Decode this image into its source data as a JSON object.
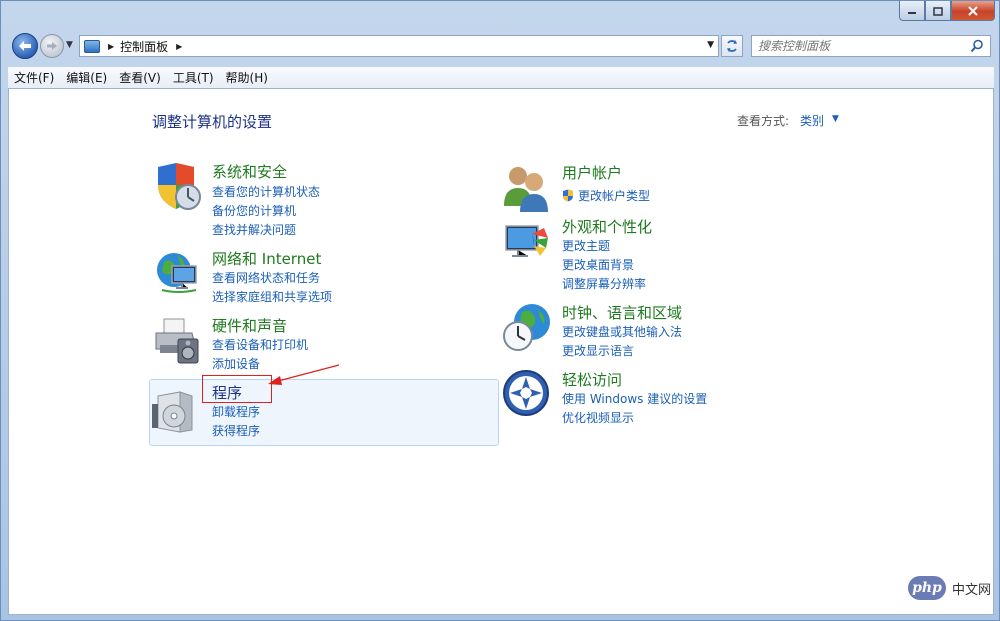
{
  "address": {
    "breadcrumb": "控制面板"
  },
  "search": {
    "placeholder": "搜索控制面板"
  },
  "menubar": {
    "items": [
      "文件(F)",
      "编辑(E)",
      "查看(V)",
      "工具(T)",
      "帮助(H)"
    ]
  },
  "main": {
    "title": "调整计算机的设置",
    "view_by_label": "查看方式:",
    "view_by_value": "类别"
  },
  "categories": [
    {
      "title": "系统和安全",
      "links": [
        "查看您的计算机状态",
        "备份您的计算机",
        "查找并解决问题"
      ]
    },
    {
      "title": "网络和 Internet",
      "links": [
        "查看网络状态和任务",
        "选择家庭组和共享选项"
      ]
    },
    {
      "title": "硬件和声音",
      "links": [
        "查看设备和打印机",
        "添加设备"
      ]
    },
    {
      "title": "程序",
      "links": [
        "卸载程序",
        "获得程序"
      ]
    },
    {
      "title": "用户帐户",
      "links": [
        "更改帐户类型"
      ]
    },
    {
      "title": "外观和个性化",
      "links": [
        "更改主题",
        "更改桌面背景",
        "调整屏幕分辨率"
      ]
    },
    {
      "title": "时钟、语言和区域",
      "links": [
        "更改键盘或其他输入法",
        "更改显示语言"
      ]
    },
    {
      "title": "轻松访问",
      "links": [
        "使用 Windows 建议的设置",
        "优化视频显示"
      ]
    }
  ],
  "watermark": {
    "logo": "php",
    "text": "中文网"
  },
  "colors": {
    "category_title": "#1f7a1f",
    "link": "#1b5fb6",
    "page_title": "#1e3287",
    "annotation": "#e0201c"
  }
}
